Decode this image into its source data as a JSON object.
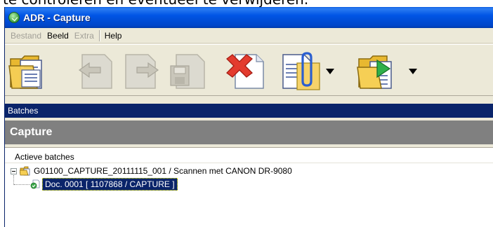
{
  "caption": {
    "text": "te controleren en eventueel te verwijderen."
  },
  "window": {
    "title": "ADR - Capture"
  },
  "menu": {
    "bestand": "Bestand",
    "beeld": "Beeld",
    "extra": "Extra",
    "help": "Help"
  },
  "toolbar": {
    "buttons": [
      {
        "name": "open-batch",
        "icon": "folder-document-icon",
        "enabled": true
      },
      {
        "name": "previous",
        "icon": "arrow-left-icon",
        "enabled": false
      },
      {
        "name": "next",
        "icon": "arrow-right-icon",
        "enabled": false
      },
      {
        "name": "save",
        "icon": "floppy-disk-icon",
        "enabled": false
      },
      {
        "name": "delete",
        "icon": "red-x-document-icon",
        "enabled": true
      },
      {
        "name": "attach",
        "icon": "paperclip-document-icon",
        "enabled": true,
        "dropdown": true
      },
      {
        "name": "process",
        "icon": "play-folder-icon",
        "enabled": true,
        "dropdown": true
      }
    ]
  },
  "batches_bar": {
    "label": "Batches"
  },
  "capture_header": {
    "label": "Capture"
  },
  "tree": {
    "section_label": "Actieve batches",
    "batch": {
      "label": "G01100_CAPTURE_20111115_001 / Scannen met CANON DR-9080"
    },
    "document": {
      "label": "Doc. 0001 [ 1107868 / CAPTURE ]"
    }
  },
  "colors": {
    "title_bar": "#0055e5",
    "selection": "#0a246a",
    "capture_header": "#808080",
    "window_bg": "#ece9d8"
  }
}
